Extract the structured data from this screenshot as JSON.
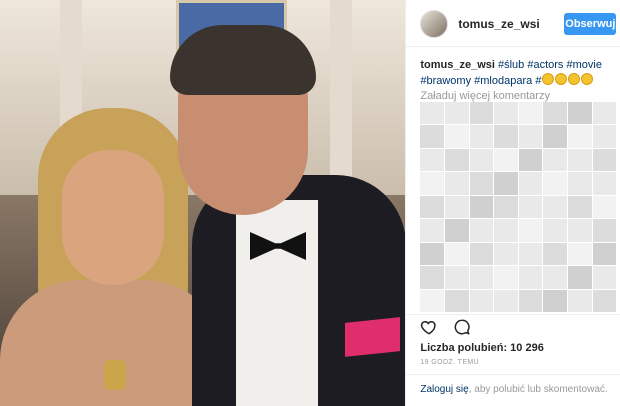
{
  "header": {
    "username": "tomus_ze_wsi",
    "follow_label": "Obserwuj"
  },
  "caption": {
    "username": "tomus_ze_wsi",
    "hashtags": [
      "#ślub",
      "#actors",
      "#movie",
      "#brawomy",
      "#mlodapara",
      "#"
    ]
  },
  "comments": {
    "load_more": "Załaduj więcej komentarzy"
  },
  "actions": {
    "like_icon": "heart-icon",
    "comment_icon": "comment-icon"
  },
  "stats": {
    "likes_label": "Liczba polubień: 10 296",
    "time": "19 GODZ. TEMU"
  },
  "footer": {
    "login_link": "Zaloguj się",
    "login_rest": ", aby polubić lub skomentować."
  },
  "colors": {
    "accent": "#3897f0",
    "link": "#003569"
  }
}
